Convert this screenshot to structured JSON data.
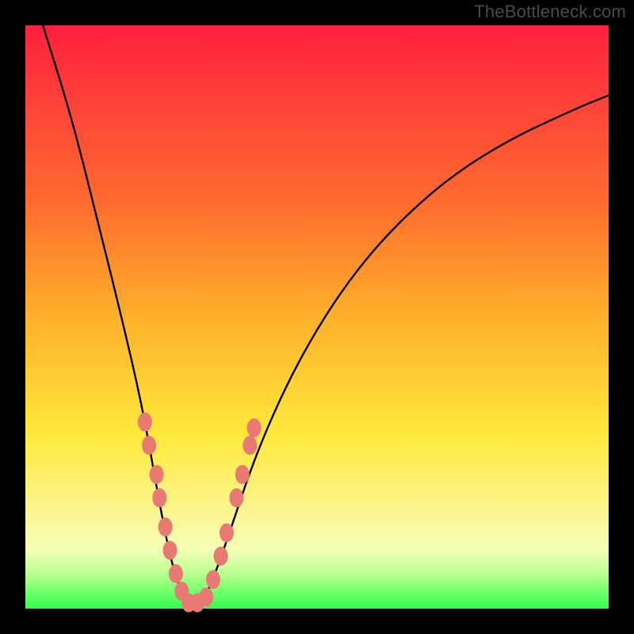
{
  "watermark": "TheBottleneck.com",
  "chart_data": {
    "type": "line",
    "title": "",
    "xlabel": "",
    "ylabel": "",
    "xlim": [
      0,
      100
    ],
    "ylim": [
      0,
      100
    ],
    "grid": false,
    "legend": false,
    "note": "Axes are unlabeled in the image; coordinates are read as approximate percentages of the plot area. V-shaped black curve descending from top-left and top-right into a minimum near x≈28, y≈0. Salmon-colored data points cluster along both arms of the V near the minimum.",
    "series": [
      {
        "name": "v-curve",
        "type": "line",
        "color": "#000000",
        "points": [
          {
            "x": 3,
            "y": 100
          },
          {
            "x": 8,
            "y": 84
          },
          {
            "x": 12,
            "y": 68
          },
          {
            "x": 16,
            "y": 52
          },
          {
            "x": 20,
            "y": 35
          },
          {
            "x": 23,
            "y": 18
          },
          {
            "x": 25,
            "y": 8
          },
          {
            "x": 27,
            "y": 2
          },
          {
            "x": 29,
            "y": 0
          },
          {
            "x": 31,
            "y": 2
          },
          {
            "x": 34,
            "y": 10
          },
          {
            "x": 40,
            "y": 28
          },
          {
            "x": 48,
            "y": 45
          },
          {
            "x": 58,
            "y": 60
          },
          {
            "x": 70,
            "y": 72
          },
          {
            "x": 82,
            "y": 80
          },
          {
            "x": 95,
            "y": 86
          },
          {
            "x": 100,
            "y": 88
          }
        ]
      },
      {
        "name": "data-points",
        "type": "scatter",
        "color": "#e87a73",
        "points": [
          {
            "x": 20.5,
            "y": 32
          },
          {
            "x": 21.2,
            "y": 28
          },
          {
            "x": 22.5,
            "y": 23
          },
          {
            "x": 23.0,
            "y": 19
          },
          {
            "x": 24.0,
            "y": 14
          },
          {
            "x": 24.8,
            "y": 10
          },
          {
            "x": 25.8,
            "y": 6
          },
          {
            "x": 26.8,
            "y": 3
          },
          {
            "x": 28.0,
            "y": 1
          },
          {
            "x": 29.5,
            "y": 1
          },
          {
            "x": 31.0,
            "y": 2
          },
          {
            "x": 32.2,
            "y": 5
          },
          {
            "x": 33.5,
            "y": 9
          },
          {
            "x": 34.5,
            "y": 13
          },
          {
            "x": 36.2,
            "y": 19
          },
          {
            "x": 37.2,
            "y": 23
          },
          {
            "x": 38.5,
            "y": 28
          },
          {
            "x": 39.2,
            "y": 31
          }
        ]
      }
    ],
    "background_gradient": {
      "direction": "vertical",
      "stops": [
        {
          "pos": 0,
          "color": "#ff1f3e"
        },
        {
          "pos": 50,
          "color": "#ffb02a"
        },
        {
          "pos": 70,
          "color": "#ffe83a"
        },
        {
          "pos": 90,
          "color": "#f3ffb8"
        },
        {
          "pos": 100,
          "color": "#2fff4a"
        }
      ]
    }
  }
}
